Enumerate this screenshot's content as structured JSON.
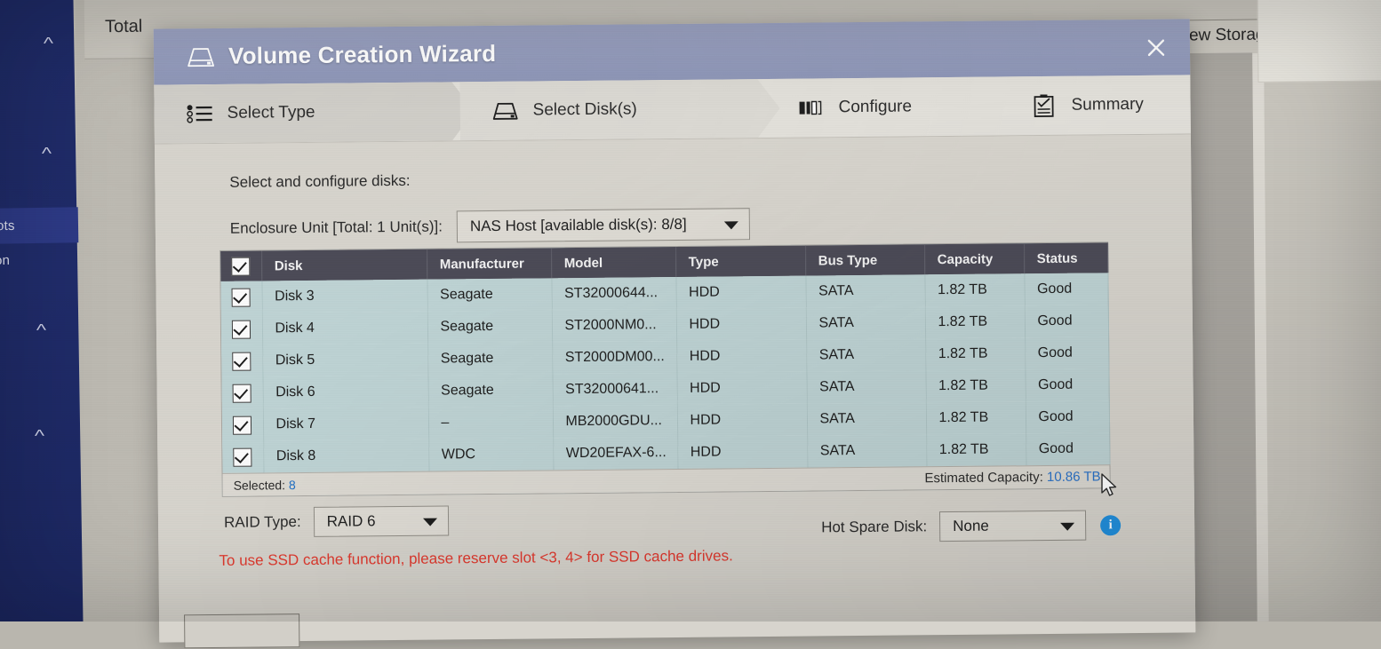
{
  "background": {
    "top_label": "Total",
    "new_storage_button": "ew Storag",
    "sidebar_items": [
      {
        "label": "ots"
      },
      {
        "label": "on"
      }
    ],
    "chevron_icon": "chevron-up"
  },
  "dialog": {
    "title": "Volume Creation Wizard",
    "title_icon": "disk-drive-icon",
    "close_icon": "close-icon",
    "steps": [
      {
        "label": "Select Type",
        "icon": "list-bullets-icon",
        "state": "done"
      },
      {
        "label": "Select Disk(s)",
        "icon": "disk-drive-icon",
        "state": "active"
      },
      {
        "label": "Configure",
        "icon": "raid-blocks-icon",
        "state": "pending"
      },
      {
        "label": "Summary",
        "icon": "clipboard-check-icon",
        "state": "pending"
      }
    ],
    "lead_text": "Select and configure disks:",
    "enclosure": {
      "label": "Enclosure Unit [Total: 1 Unit(s)]:",
      "value": "NAS Host [available disk(s): 8/8]",
      "caret_icon": "chevron-down-icon"
    },
    "table": {
      "columns": [
        "Disk",
        "Manufacturer",
        "Model",
        "Type",
        "Bus Type",
        "Capacity",
        "Status"
      ],
      "select_all_checked": true,
      "rows": [
        {
          "checked": true,
          "disk": "Disk 3",
          "manufacturer": "Seagate",
          "model": "ST32000644...",
          "type": "HDD",
          "bus": "SATA",
          "capacity": "1.82 TB",
          "status": "Good"
        },
        {
          "checked": true,
          "disk": "Disk 4",
          "manufacturer": "Seagate",
          "model": "ST2000NM0...",
          "type": "HDD",
          "bus": "SATA",
          "capacity": "1.82 TB",
          "status": "Good"
        },
        {
          "checked": true,
          "disk": "Disk 5",
          "manufacturer": "Seagate",
          "model": "ST2000DM00...",
          "type": "HDD",
          "bus": "SATA",
          "capacity": "1.82 TB",
          "status": "Good"
        },
        {
          "checked": true,
          "disk": "Disk 6",
          "manufacturer": "Seagate",
          "model": "ST32000641...",
          "type": "HDD",
          "bus": "SATA",
          "capacity": "1.82 TB",
          "status": "Good"
        },
        {
          "checked": true,
          "disk": "Disk 7",
          "manufacturer": "–",
          "model": "MB2000GDU...",
          "type": "HDD",
          "bus": "SATA",
          "capacity": "1.82 TB",
          "status": "Good"
        },
        {
          "checked": true,
          "disk": "Disk 8",
          "manufacturer": "WDC",
          "model": "WD20EFAX-6...",
          "type": "HDD",
          "bus": "SATA",
          "capacity": "1.82 TB",
          "status": "Good"
        }
      ],
      "selected_label": "Selected:",
      "selected_count": "8",
      "estimated_capacity_label": "Estimated Capacity:",
      "estimated_capacity_value": "10.86 TB"
    },
    "raid": {
      "label": "RAID Type:",
      "value": "RAID 6",
      "caret_icon": "chevron-down-icon"
    },
    "hot_spare": {
      "label": "Hot Spare Disk:",
      "value": "None",
      "caret_icon": "chevron-down-icon",
      "info_icon": "info-icon",
      "info_glyph": "i"
    },
    "warning": "To use SSD cache function, please reserve slot <3, 4> for SSD cache drives."
  },
  "colors": {
    "titlebar": "#959dbd",
    "table_header": "#4c4b57",
    "table_row": "#bed3d4",
    "warning_text": "#e03a2f",
    "link_blue": "#2a72c8",
    "info_blue": "#2290dd",
    "sidebar_navy": "#1e2a66"
  },
  "cursor": {
    "icon": "mouse-pointer-icon"
  }
}
